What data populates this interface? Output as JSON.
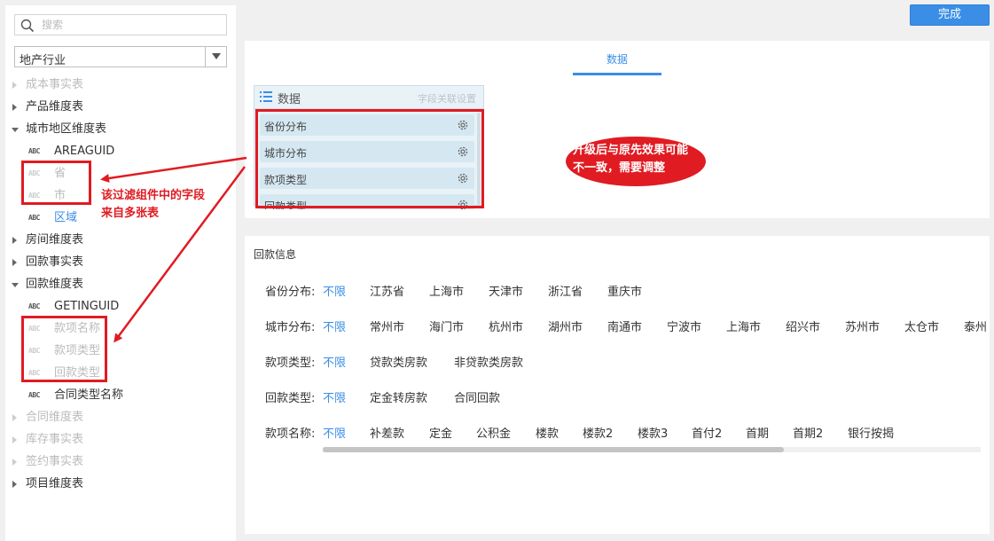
{
  "sidebar": {
    "search_placeholder": "搜索",
    "package_select": "地产行业",
    "tree": [
      {
        "type": "table",
        "label": "成本事实表",
        "state": "collapsed",
        "dim": true
      },
      {
        "type": "table",
        "label": "产品维度表",
        "state": "collapsed",
        "dim": false
      },
      {
        "type": "table",
        "label": "城市地区维度表",
        "state": "expanded",
        "dim": false
      },
      {
        "type": "field",
        "label": "AREAGUID",
        "dim": false
      },
      {
        "type": "field",
        "label": "省",
        "dim": true
      },
      {
        "type": "field",
        "label": "市",
        "dim": true
      },
      {
        "type": "field",
        "label": "区域",
        "active": true
      },
      {
        "type": "table",
        "label": "房间维度表",
        "state": "collapsed",
        "dim": false
      },
      {
        "type": "table",
        "label": "回款事实表",
        "state": "collapsed",
        "dim": false
      },
      {
        "type": "table",
        "label": "回款维度表",
        "state": "expanded",
        "dim": false
      },
      {
        "type": "field",
        "label": "GETINGUID",
        "dim": false
      },
      {
        "type": "field",
        "label": "款项名称",
        "dim": true
      },
      {
        "type": "field",
        "label": "款项类型",
        "dim": true
      },
      {
        "type": "field",
        "label": "回款类型",
        "dim": true
      },
      {
        "type": "field",
        "label": "合同类型名称",
        "dim": false
      },
      {
        "type": "table",
        "label": "合同维度表",
        "state": "collapsed",
        "dim": true
      },
      {
        "type": "table",
        "label": "库存事实表",
        "state": "collapsed",
        "dim": true
      },
      {
        "type": "table",
        "label": "签约事实表",
        "state": "collapsed",
        "dim": true
      },
      {
        "type": "table",
        "label": "项目维度表",
        "state": "collapsed",
        "dim": false
      }
    ],
    "field_type_badge": "ABC"
  },
  "toolbar": {
    "done_label": "完成"
  },
  "data_panel": {
    "tab_label": "数据",
    "box_title": "数据",
    "link_label": "字段关联设置",
    "fields": [
      "省份分布",
      "城市分布",
      "款项类型",
      "回款类型"
    ]
  },
  "filter_panel": {
    "title": "回款信息",
    "rows": [
      {
        "label": "省份分布:",
        "options": [
          "不限",
          "江苏省",
          "上海市",
          "天津市",
          "浙江省",
          "重庆市"
        ]
      },
      {
        "label": "城市分布:",
        "options": [
          "不限",
          "常州市",
          "海门市",
          "杭州市",
          "湖州市",
          "南通市",
          "宁波市",
          "上海市",
          "绍兴市",
          "苏州市",
          "太仓市",
          "泰州"
        ]
      },
      {
        "label": "款项类型:",
        "options": [
          "不限",
          "贷款类房款",
          "非贷款类房款"
        ]
      },
      {
        "label": "回款类型:",
        "options": [
          "不限",
          "定金转房款",
          "合同回款"
        ]
      },
      {
        "label": "款项名称:",
        "options": [
          "不限",
          "补差款",
          "定金",
          "公积金",
          "楼款",
          "楼款2",
          "楼款3",
          "首付2",
          "首期",
          "首期2",
          "银行按揭"
        ]
      }
    ]
  },
  "annotations": {
    "left_note_line1": "该过滤组件中的字段",
    "left_note_line2": "来自多张表",
    "bubble_line1": "升级后与原先效果可能",
    "bubble_line2": "不一致，需要调整",
    "color": "#e01b22"
  },
  "colors": {
    "accent": "#3a8ee6",
    "annotation": "#e01b22"
  }
}
